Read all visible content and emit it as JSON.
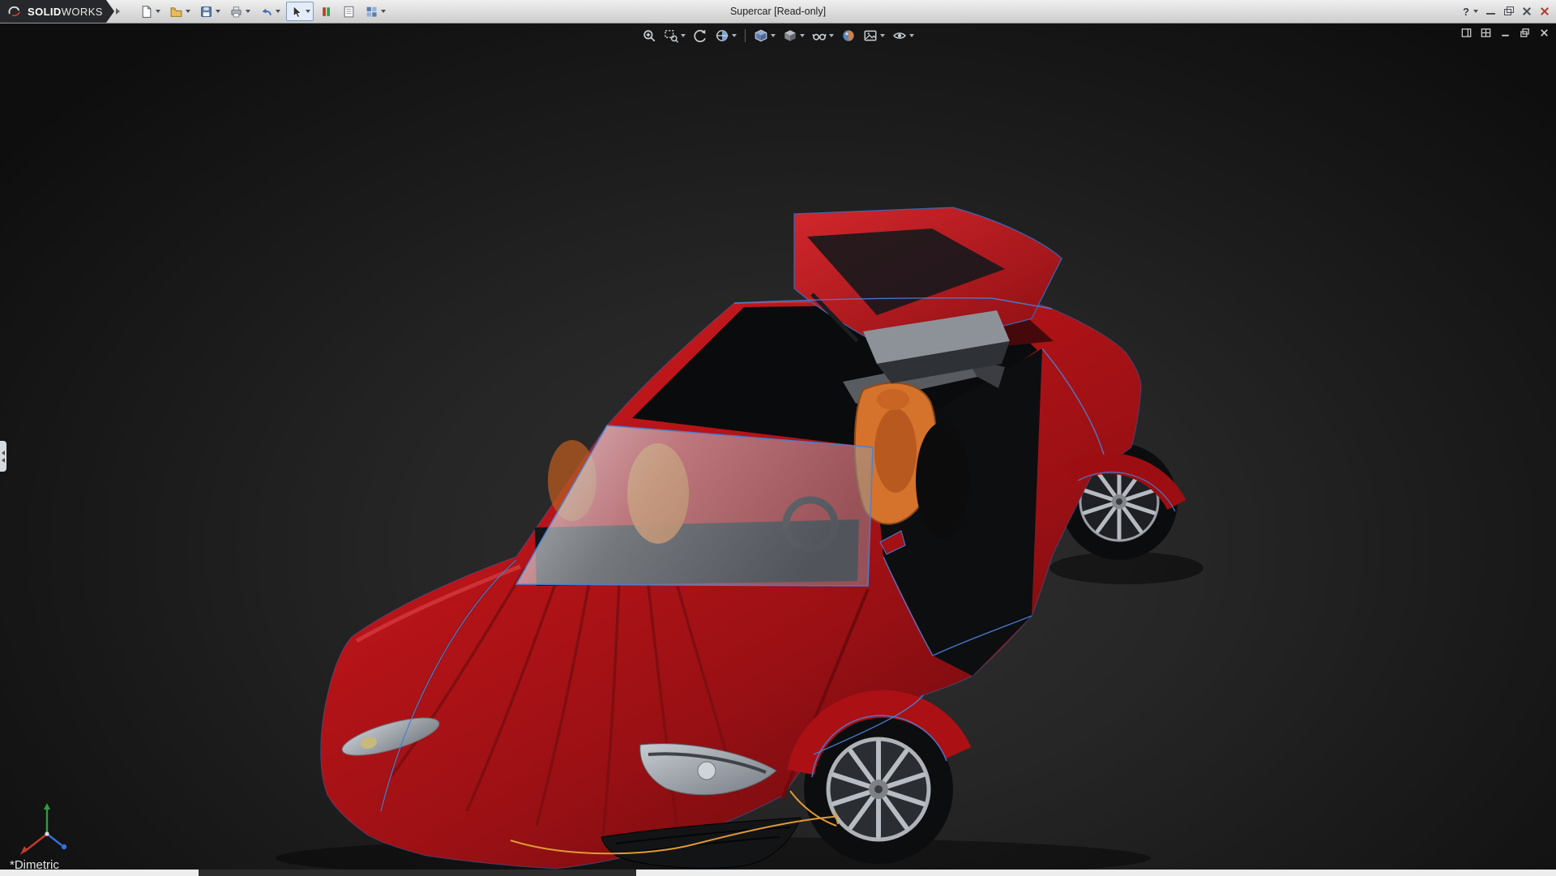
{
  "window": {
    "title": "Supercar [Read-only]",
    "brand": {
      "logo": "dassault-3ds-logo",
      "prefix_bold": "SOLID",
      "suffix_light": "WORKS"
    },
    "controls": {
      "help": "?",
      "minimize": "minimize",
      "restore": "restore",
      "close": "close",
      "app_close": "close-red"
    }
  },
  "quick_access_toolbar": {
    "buttons": [
      {
        "name": "new-document",
        "icon": "new-page-icon",
        "has_dropdown": true
      },
      {
        "name": "open-document",
        "icon": "open-folder-icon",
        "has_dropdown": true
      },
      {
        "name": "save",
        "icon": "save-floppy-icon",
        "has_dropdown": true
      },
      {
        "name": "print",
        "icon": "printer-icon",
        "has_dropdown": true
      },
      {
        "name": "undo",
        "icon": "undo-arrow-icon",
        "has_dropdown": true
      },
      {
        "name": "select",
        "icon": "cursor-arrow-icon",
        "has_dropdown": true,
        "active": true
      },
      {
        "name": "rebuild",
        "icon": "rebuild-bars-icon",
        "has_dropdown": false
      },
      {
        "name": "file-properties",
        "icon": "properties-sheet-icon",
        "has_dropdown": false
      },
      {
        "name": "options",
        "icon": "options-grid-icon",
        "has_dropdown": true
      }
    ]
  },
  "heads_up_toolbar": {
    "buttons": [
      {
        "name": "zoom-to-fit",
        "icon": "magnifier-icon",
        "has_dropdown": false
      },
      {
        "name": "zoom-to-area",
        "icon": "zoom-area-icon",
        "has_dropdown": true
      },
      {
        "name": "previous-view",
        "icon": "previous-view-arrow-icon",
        "has_dropdown": false
      },
      {
        "name": "section-view",
        "icon": "section-sphere-icon",
        "has_dropdown": true
      },
      {
        "name": "view-orientation",
        "icon": "view-cube-icon",
        "has_dropdown": true
      },
      {
        "name": "display-style",
        "icon": "shaded-cube-icon",
        "has_dropdown": true
      },
      {
        "name": "hide-show-items",
        "icon": "glasses-icon",
        "has_dropdown": true
      },
      {
        "name": "edit-appearance",
        "icon": "appearance-ball-icon",
        "has_dropdown": false
      },
      {
        "name": "apply-scene",
        "icon": "scene-picture-icon",
        "has_dropdown": true
      },
      {
        "name": "view-settings",
        "icon": "eye-icon",
        "has_dropdown": true
      }
    ]
  },
  "document_window_controls": [
    {
      "name": "viewport-pane-single",
      "icon": "pane-single-icon"
    },
    {
      "name": "viewport-pane-split",
      "icon": "pane-split-icon"
    },
    {
      "name": "doc-minimize",
      "icon": "minimize-icon"
    },
    {
      "name": "doc-restore",
      "icon": "restore-icon"
    },
    {
      "name": "doc-close",
      "icon": "close-icon"
    }
  ],
  "viewport": {
    "view_label": "*Dimetric",
    "model": "Supercar",
    "triad_axes": [
      "x-red",
      "y-green",
      "z-blue"
    ],
    "colors": {
      "background_center": "#2f2f2f",
      "background_edge": "#0e0e0e",
      "car_body_red": "#b01215",
      "edge_highlight_blue": "#4a7fd6",
      "interior_seat_orange": "#d5732c",
      "construction_line_orange": "#e09a35",
      "glass_gray": "#c3c9cf"
    }
  }
}
